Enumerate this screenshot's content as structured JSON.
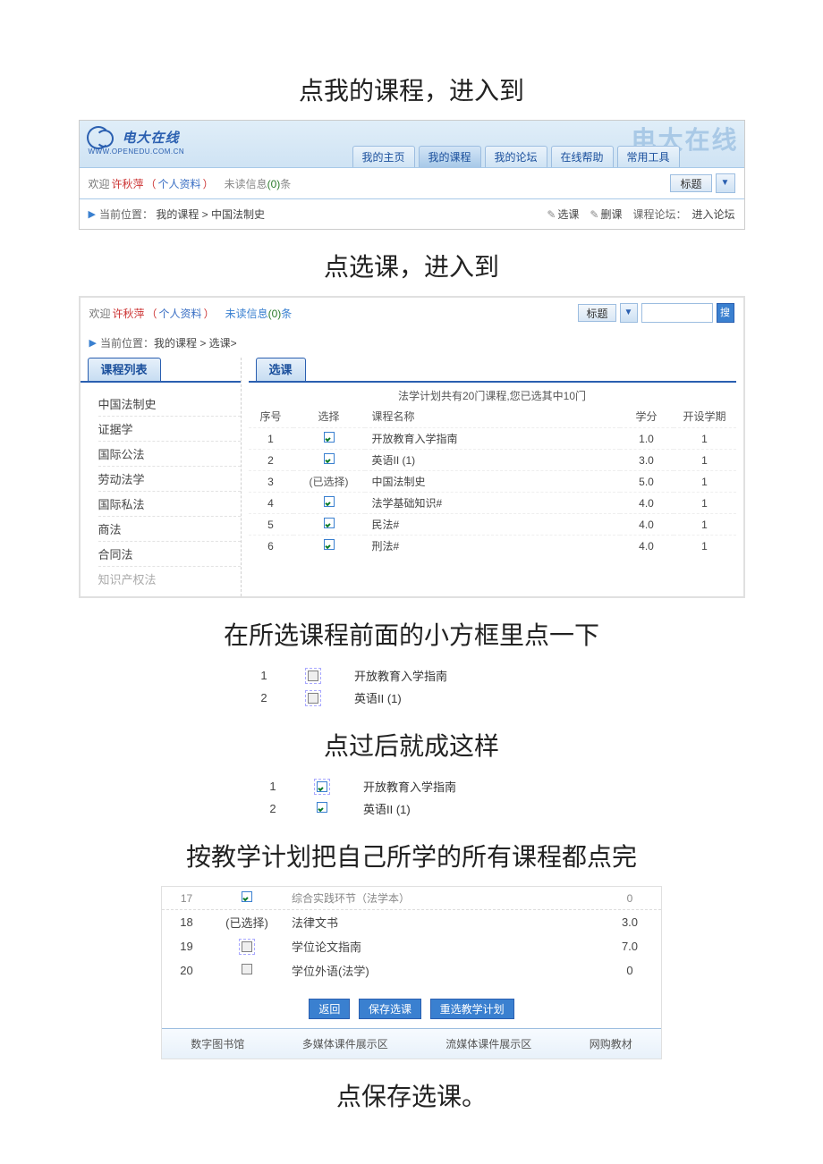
{
  "instructions": {
    "i1": "点我的课程，进入到",
    "i2": "点选课，进入到",
    "i3": "在所选课程前面的小方框里点一下",
    "i4": "点过后就成这样",
    "i5": "按教学计划把自己所学的所有课程都点完",
    "i6": "点保存选课。"
  },
  "s1": {
    "logo_text": "电大在线",
    "logo_sub": "WWW.OPENEDU.COM.CN",
    "watermark": "电大在线",
    "tabs": {
      "home": "我的主页",
      "course": "我的课程",
      "forum": "我的论坛",
      "help": "在线帮助",
      "tools": "常用工具"
    },
    "greet": "欢迎",
    "user": "许秋萍",
    "profile": "个人资料",
    "unread_prefix": "未读信息",
    "unread_count": "(0)",
    "unread_suffix": "条",
    "title_label": "标题",
    "loc_label": "当前位置：",
    "loc_path": "我的课程 > 中国法制史",
    "act_select": "选课",
    "act_delete": "删课",
    "forum_label": "课程论坛：",
    "forum_go": "进入论坛"
  },
  "s2": {
    "greet": "欢迎",
    "user": "许秋萍",
    "profile": "个人资料",
    "unread_prefix": "未读信息",
    "unread_count": "(0)",
    "unread_suffix": "条",
    "title_label": "标题",
    "search_btn": "搜",
    "loc_label": "当前位置：",
    "loc_path": "我的课程 > 选课>",
    "side_tab": "课程列表",
    "main_tab": "选课",
    "side_items": {
      "c1": "中国法制史",
      "c2": "证据学",
      "c3": "国际公法",
      "c4": "劳动法学",
      "c5": "国际私法",
      "c6": "商法",
      "c7": "合同法",
      "c8": "知识产权法"
    },
    "desc": "法学计划共有20门课程,您已选其中10门",
    "headers": {
      "no": "序号",
      "sel": "选择",
      "name": "课程名称",
      "credit": "学分",
      "term": "开设学期"
    },
    "selected_text": "(已选择)",
    "rows": {
      "r1": {
        "no": "1",
        "sel": "chk",
        "name": "开放教育入学指南",
        "credit": "1.0",
        "term": "1"
      },
      "r2": {
        "no": "2",
        "sel": "chk",
        "name": "英语II (1)",
        "credit": "3.0",
        "term": "1"
      },
      "r3": {
        "no": "3",
        "sel": "selected",
        "name": "中国法制史",
        "credit": "5.0",
        "term": "1"
      },
      "r4": {
        "no": "4",
        "sel": "chk",
        "name": "法学基础知识#",
        "credit": "4.0",
        "term": "1"
      },
      "r5": {
        "no": "5",
        "sel": "chk",
        "name": "民法#",
        "credit": "4.0",
        "term": "1"
      },
      "r6": {
        "no": "6",
        "sel": "chk",
        "name": "刑法#",
        "credit": "4.0",
        "term": "1"
      }
    }
  },
  "s3": {
    "r1": {
      "no": "1",
      "name": "开放教育入学指南"
    },
    "r2": {
      "no": "2",
      "name": "英语II (1)"
    }
  },
  "s4": {
    "r1": {
      "no": "1",
      "name": "开放教育入学指南"
    },
    "r2": {
      "no": "2",
      "name": "英语II (1)"
    }
  },
  "s5": {
    "selected_text": "(已选择)",
    "rows": {
      "r17": {
        "no": "17",
        "sel": "chk",
        "name": "综合实践环节（法学本）",
        "credit": "0"
      },
      "r18": {
        "no": "18",
        "sel": "selected",
        "name": "法律文书",
        "credit": "3.0"
      },
      "r19": {
        "no": "19",
        "sel": "box",
        "name": "学位论文指南",
        "credit": "7.0"
      },
      "r20": {
        "no": "20",
        "sel": "box",
        "name": "学位外语(法学)",
        "credit": "0"
      }
    },
    "btn_back": "返回",
    "btn_save": "保存选课",
    "btn_reselect": "重选教学计划",
    "footer": {
      "f1": "数字图书馆",
      "f2": "多媒体课件展示区",
      "f3": "流媒体课件展示区",
      "f4": "网购教材"
    }
  }
}
